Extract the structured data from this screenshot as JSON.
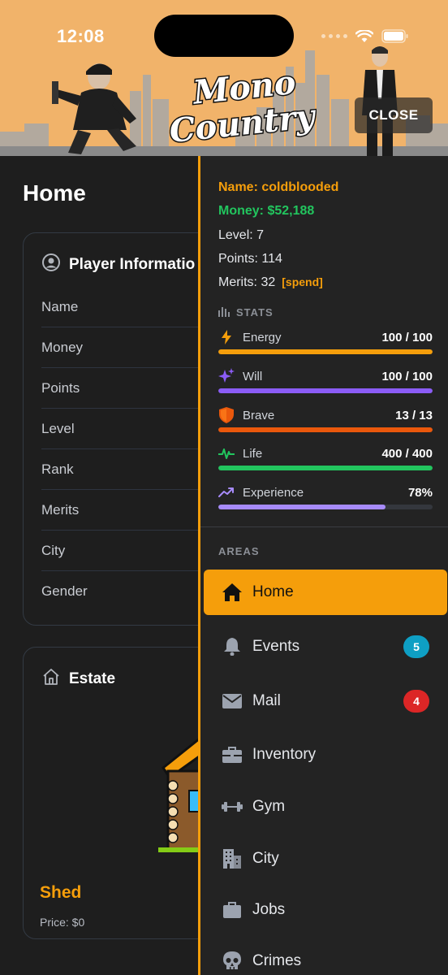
{
  "status_bar": {
    "time": "12:08"
  },
  "header": {
    "logo_line1": "Mono",
    "logo_line2": "Country",
    "close_label": "CLOSE"
  },
  "page": {
    "title": "Home"
  },
  "player_card": {
    "title": "Player Informatio",
    "rows": [
      "Name",
      "Money",
      "Points",
      "Level",
      "Rank",
      "Merits",
      "City",
      "Gender"
    ]
  },
  "estate_card": {
    "title": "Estate",
    "name": "Shed",
    "price": "Price: $0"
  },
  "drawer": {
    "name": "Name: coldblooded",
    "money": "Money: $52,188",
    "level": "Level: 7",
    "points": "Points: 114",
    "merits": "Merits: 32",
    "spend": "[spend]",
    "stats_title": "STATS",
    "stats": [
      {
        "name": "Energy",
        "value": "100 / 100",
        "fraction": 1.0,
        "color": "#f59e0b",
        "icon": "lightning-icon"
      },
      {
        "name": "Will",
        "value": "100 / 100",
        "fraction": 1.0,
        "color": "#8b5cf6",
        "icon": "sparkles-icon"
      },
      {
        "name": "Brave",
        "value": "13 / 13",
        "fraction": 1.0,
        "color": "#ea580c",
        "icon": "shield-icon"
      },
      {
        "name": "Life",
        "value": "400 / 400",
        "fraction": 1.0,
        "color": "#22c55e",
        "icon": "heartbeat-icon"
      },
      {
        "name": "Experience",
        "value": "78%",
        "fraction": 0.78,
        "color": "#a78bfa",
        "icon": "trend-up-icon"
      }
    ],
    "areas_title": "AREAS",
    "nav": [
      {
        "label": "Home",
        "icon": "home-icon",
        "active": true
      },
      {
        "label": "Events",
        "icon": "bell-icon",
        "badge": "5",
        "badge_color": "#0e9fc4"
      },
      {
        "label": "Mail",
        "icon": "mail-icon",
        "badge": "4",
        "badge_color": "#dc2626"
      },
      {
        "label": "Inventory",
        "icon": "briefcase-icon"
      },
      {
        "label": "Gym",
        "icon": "dumbbell-icon"
      },
      {
        "label": "City",
        "icon": "buildings-icon"
      },
      {
        "label": "Jobs",
        "icon": "suitcase-icon"
      },
      {
        "label": "Crimes",
        "icon": "skull-icon"
      }
    ]
  }
}
